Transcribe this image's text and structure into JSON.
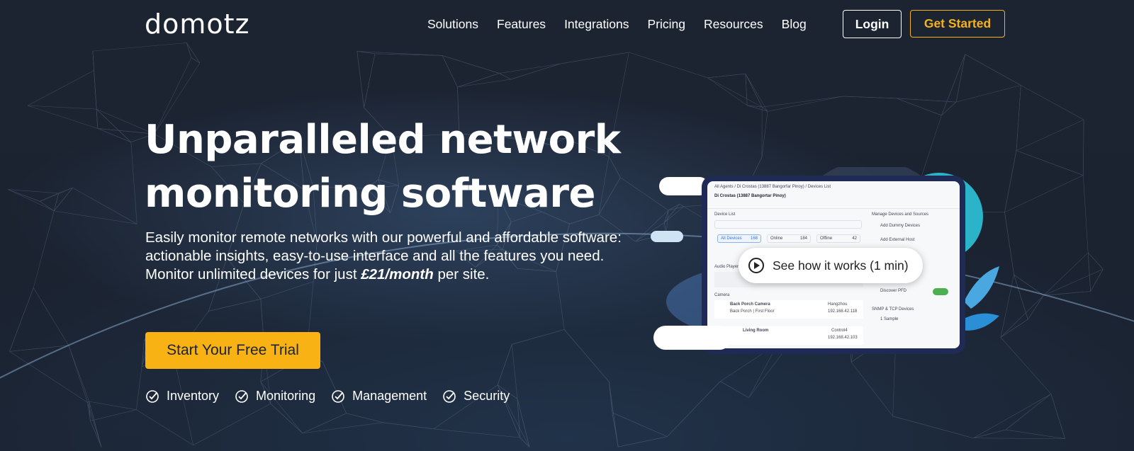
{
  "header": {
    "logo": "domotz",
    "nav": [
      "Solutions",
      "Features",
      "Integrations",
      "Pricing",
      "Resources",
      "Blog"
    ],
    "login_label": "Login",
    "get_started_label": "Get Started"
  },
  "hero": {
    "headline_line1": "Unparalleled network",
    "headline_line2": "monitoring software",
    "desc_1": "Easily monitor remote networks with our powerful and affordable software: actionable insights, easy-to-use interface and all the features you need.",
    "desc_2_prefix": "Monitor unlimited devices for just ",
    "price": "£21/month",
    "desc_2_suffix": " per site.",
    "cta_label": "Start Your Free Trial",
    "features": [
      "Inventory",
      "Monitoring",
      "Management",
      "Security"
    ]
  },
  "video": {
    "label": "See how it works (1 min)"
  },
  "device_screen": {
    "breadcrumb": "All Agents / Di Crostas (13887 Bangorfar Pinoy) / Devices List",
    "agent_title": "Di Crostas (13887 Bangortar Pinoy)",
    "section_device_list": "Device List",
    "filter_all": "All Devices",
    "filter_all_count": "168",
    "filter_online": "Online",
    "filter_online_count": "184",
    "filter_offline": "Offline",
    "filter_offline_count": "42",
    "group_audio": "Audio Player",
    "group_camera": "Camera",
    "camera_name": "Back Porch Camera",
    "camera_sub": "Back Porch | First Floor",
    "camera_vendor": "Hangzhou",
    "camera_ip": "192.168.42.118",
    "living_room": "Living Room",
    "living_vendor": "Control4",
    "living_ip": "192.168.42.103",
    "side_title": "Manage Devices and Sources",
    "side_add_dummy": "Add Dummy Devices",
    "side_add_external": "Add External Host",
    "side_discover": "Discover PFD",
    "side_snmp": "SNMP & TCP Devices",
    "side_sample": "1 Sample"
  },
  "colors": {
    "background": "#1b2230",
    "accent": "#f8b214"
  }
}
